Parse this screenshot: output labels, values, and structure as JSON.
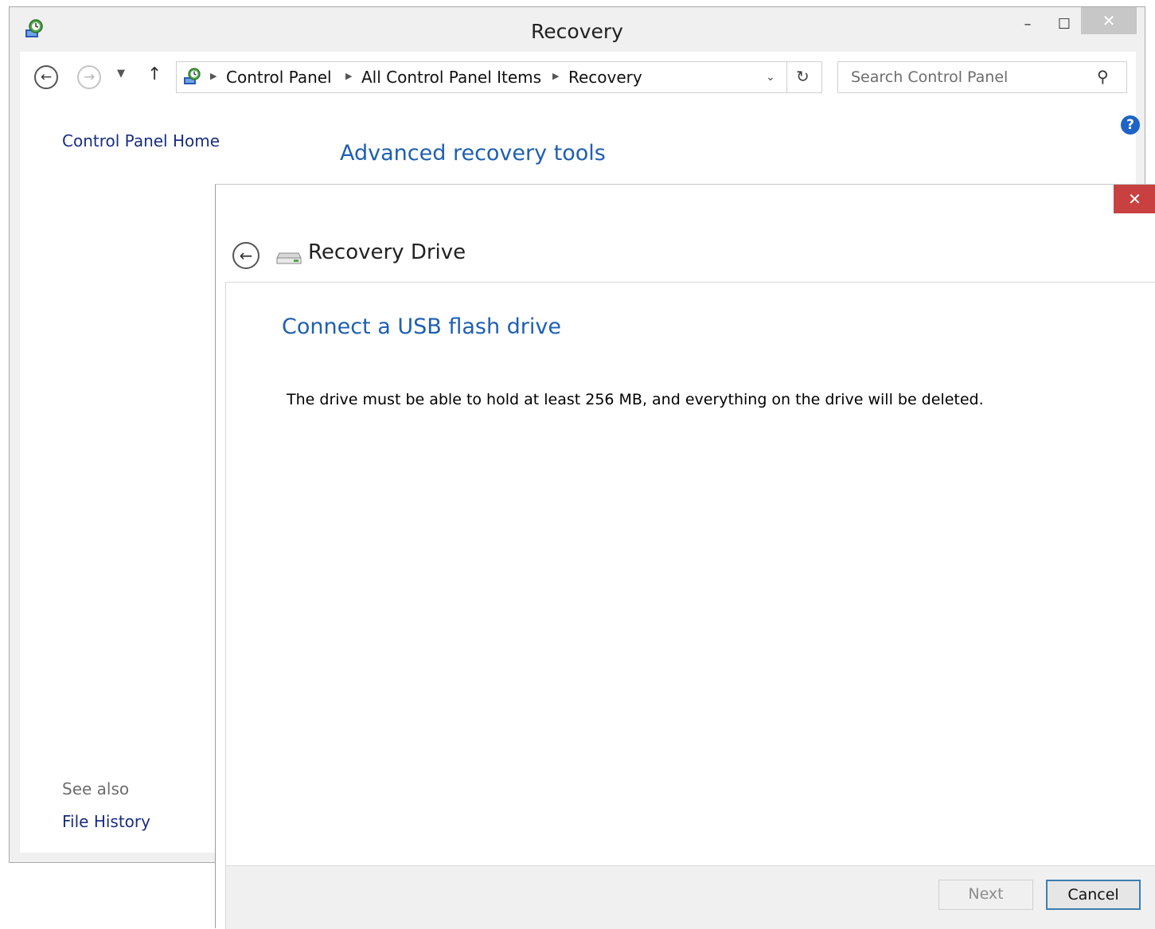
{
  "window": {
    "title": "Recovery",
    "minimize_label": "–",
    "maximize_label": "☐",
    "close_label": "✕"
  },
  "nav": {
    "back_label": "←",
    "forward_label": "→",
    "recent_label": "▼",
    "up_label": "↑",
    "breadcrumb": [
      "Control Panel",
      "All Control Panel Items",
      "Recovery"
    ],
    "separator": "▶",
    "dropdown_label": "⌄",
    "refresh_label": "↻",
    "search_placeholder": "Search Control Panel",
    "search_icon": "⚲"
  },
  "help_label": "?",
  "sidebar": {
    "home_link": "Control Panel Home",
    "see_also_label": "See also",
    "links": [
      "File History"
    ]
  },
  "main": {
    "heading": "Advanced recovery tools"
  },
  "dialog": {
    "close_label": "✕",
    "back_label": "←",
    "title": "Recovery Drive",
    "heading": "Connect a USB flash drive",
    "body_text": "The drive must be able to hold at least 256 MB, and everything on the drive will be deleted.",
    "buttons": {
      "next": "Next",
      "cancel": "Cancel"
    }
  },
  "colors": {
    "link": "#1a2d80",
    "heading": "#1e5fb3",
    "dialog_close": "#c94040",
    "help_icon": "#1e63c8",
    "default_button_border": "#3c7fb1"
  }
}
